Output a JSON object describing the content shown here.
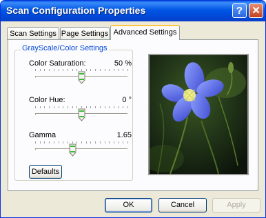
{
  "window": {
    "title": "Scan Configuration Properties",
    "help_label": "?",
    "close_label": "✕"
  },
  "tabs": [
    {
      "label": "Scan Settings"
    },
    {
      "label": "Page Settings"
    },
    {
      "label": "Advanced Settings",
      "active": true
    }
  ],
  "group": {
    "title": "GrayScale/Color Settings"
  },
  "sliders": {
    "saturation": {
      "label": "Color Saturation:",
      "value_text": "50 %",
      "fraction": 0.5
    },
    "hue": {
      "label": "Color Hue:",
      "value_text": "0 °",
      "fraction": 0.5
    },
    "gamma": {
      "label": "Gamma",
      "value_text": "1.65",
      "fraction": 0.4
    }
  },
  "buttons": {
    "defaults": "Defaults",
    "ok": "OK",
    "cancel": "Cancel",
    "apply": "Apply"
  },
  "preview": {
    "icon": "flower-photo"
  }
}
